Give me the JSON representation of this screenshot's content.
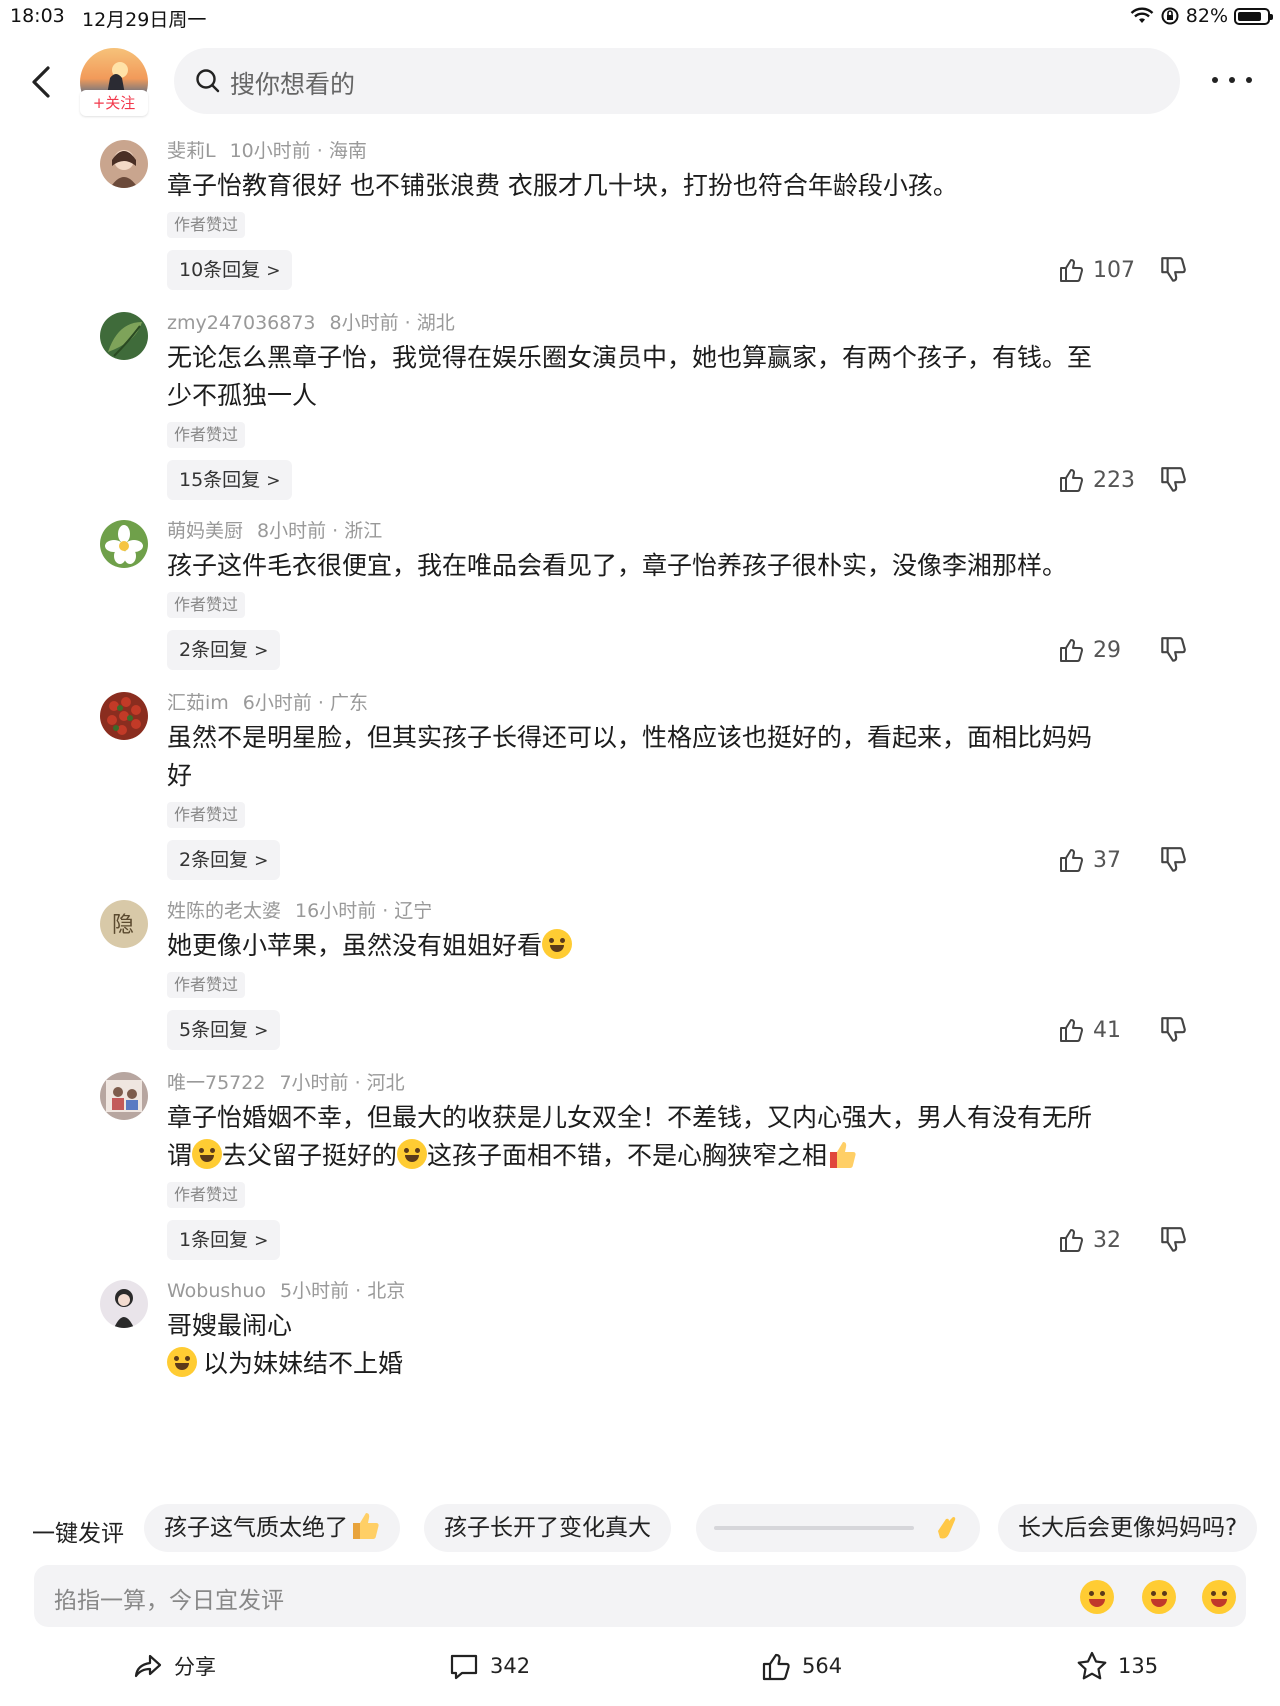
{
  "status": {
    "time": "18:03",
    "date": "12月29日周一",
    "battery": "82%",
    "battery_level": 0.82
  },
  "header": {
    "follow_label": "+关注",
    "search_placeholder": "搜你想看的"
  },
  "comments": [
    {
      "user": "斐莉L",
      "ago": "10小时前 · 海南",
      "lines": [
        "章子怡教育很好 也不铺张浪费 衣服才几十块，打扮也符合年龄段小孩。"
      ],
      "author_liked": "作者赞过",
      "replies": "10条回复",
      "likes": "107",
      "avatar_color": "#c9a58e"
    },
    {
      "user": "zmy247036873",
      "ago": "8小时前 · 湖北",
      "lines": [
        "无论怎么黑章子怡，我觉得在娱乐圈女演员中，她也算赢家，有两个孩子，有钱。至",
        "少不孤独一人"
      ],
      "author_liked": "作者赞过",
      "replies": "15条回复",
      "likes": "223",
      "avatar_color": "#3f6b3a"
    },
    {
      "user": "萌妈美厨",
      "ago": "8小时前 · 浙江",
      "lines": [
        "孩子这件毛衣很便宜，我在唯品会看见了，章子怡养孩子很朴实，没像李湘那样。"
      ],
      "author_liked": "作者赞过",
      "replies": "2条回复",
      "likes": "29",
      "avatar_color": "#6fa04a"
    },
    {
      "user": "汇茹im",
      "ago": "6小时前 · 广东",
      "lines": [
        "虽然不是明星脸，但其实孩子长得还可以，性格应该也挺好的，看起来，面相比妈妈",
        "好"
      ],
      "author_liked": "作者赞过",
      "replies": "2条回复",
      "likes": "37",
      "avatar_color": "#8a2d1f"
    },
    {
      "user": "姓陈的老太婆",
      "ago": "16小时前 · 辽宁",
      "lines": [
        "她更像小苹果，虽然没有姐姐好看"
      ],
      "emoji_after_line1": true,
      "author_liked": "作者赞过",
      "replies": "5条回复",
      "likes": "41",
      "avatar_color": "#d8c9a8"
    },
    {
      "user": "唯一75722",
      "ago": "7小时前 · 河北",
      "lines": [
        "章子怡婚姻不幸，但最大的收获是儿女双全！不差钱，又内心强大，男人有没有无所"
      ],
      "line2_parts": [
        "谓",
        "去父留子挺好的",
        "这孩子面相不错，不是心胸狭窄之相"
      ],
      "author_liked": "作者赞过",
      "replies": "1条回复",
      "likes": "32",
      "avatar_color": "#b7a6a0"
    },
    {
      "user": "Wobushuo",
      "ago": "5小时前 · 北京",
      "lines": [
        "哥嫂最闹心",
        "以为妹妹结不上婚"
      ],
      "avatar_color": "#e9e4ea"
    }
  ],
  "quick": {
    "label": "一键发评",
    "chips": [
      "孩子这气质太绝了",
      "孩子长开了变化真大",
      "",
      "长大后会更像妈妈吗?"
    ]
  },
  "composer": {
    "placeholder": "掐指一算，今日宜发评"
  },
  "bottombar": {
    "share": "分享",
    "comments": "342",
    "likes": "564",
    "favorites": "135"
  }
}
